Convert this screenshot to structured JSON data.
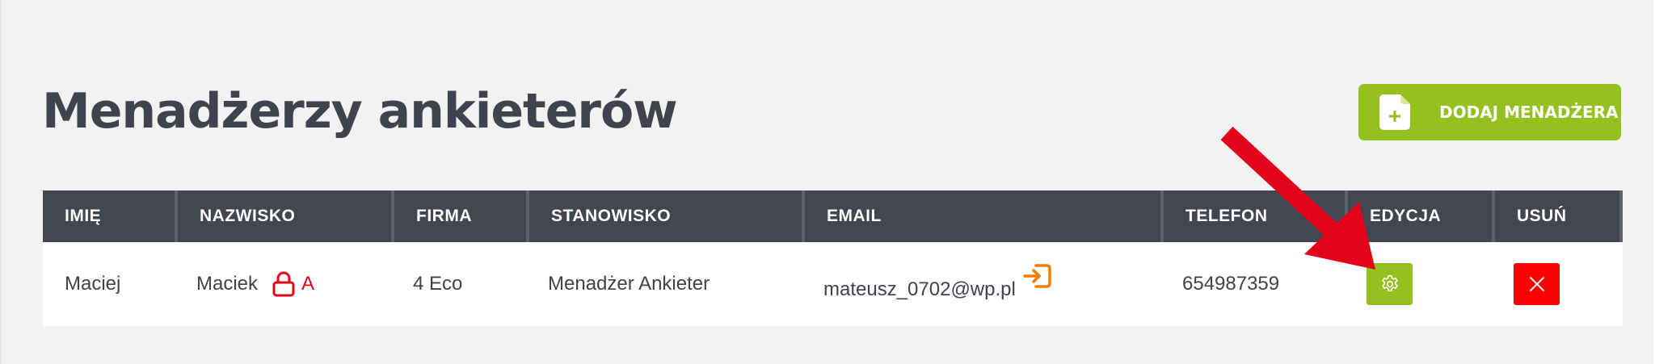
{
  "header": {
    "title": "Menadżerzy ankieterów",
    "add_button_label": "DODAJ MENADŻERA",
    "add_button_icon": "document-plus-icon"
  },
  "table": {
    "columns": [
      "IMIĘ",
      "NAZWISKO",
      "FIRMA",
      "STANOWISKO",
      "EMAIL",
      "TELEFON",
      "EDYCJA",
      "USUŃ"
    ],
    "rows": [
      {
        "first_name": "Maciej",
        "last_name": "Maciek",
        "lock_letter": "A",
        "company": "4 Eco",
        "position": "Menadżer Ankieter",
        "email": "mateusz_0702@wp.pl",
        "phone": "654987359",
        "edit_icon": "gear-icon",
        "delete_icon": "close-icon"
      }
    ]
  },
  "colors": {
    "background": "#f2f2f2",
    "title": "#40424d",
    "header_bg": "#434551",
    "accent_green": "#95c11f",
    "danger_red": "#ff0000",
    "lock_red": "#e3001b",
    "login_orange": "#f07d00",
    "annotation_arrow": "#e3001b"
  }
}
